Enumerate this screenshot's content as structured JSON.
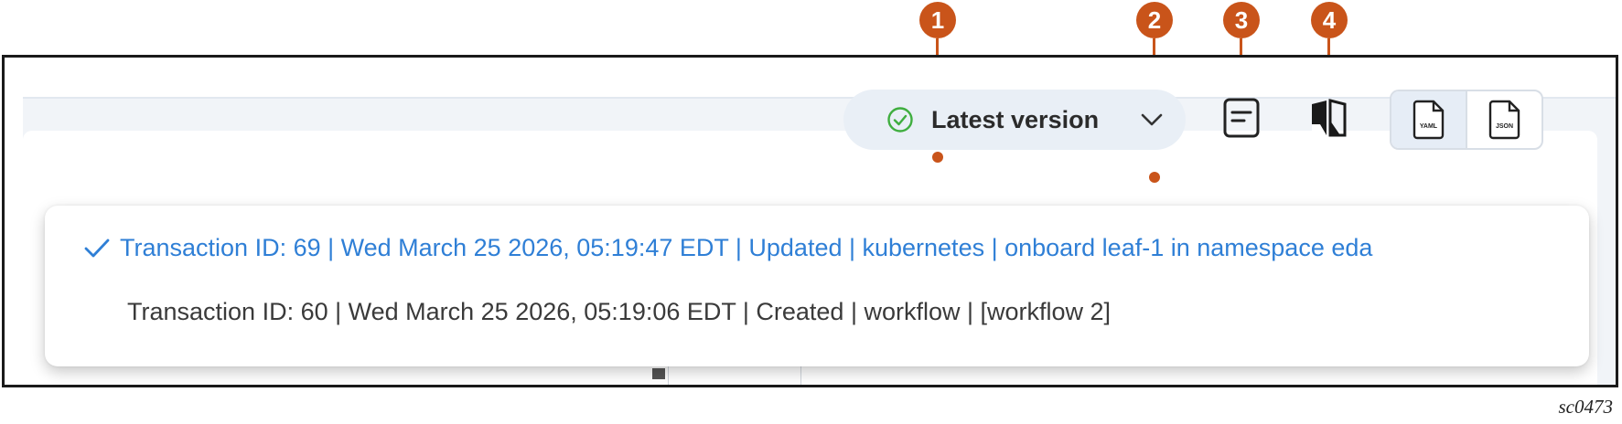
{
  "callouts": [
    "1",
    "2",
    "3",
    "4"
  ],
  "version_selector": {
    "label": "Latest version",
    "status_icon": "check-circle-icon",
    "chevron_icon": "chevron-down-icon"
  },
  "toolbar": {
    "details_icon": "document-lines-icon",
    "compare_icon": "compare-split-icon",
    "format_options": [
      {
        "label": "YAML",
        "icon": "yaml-file-icon",
        "active": true
      },
      {
        "label": "JSON",
        "icon": "json-file-icon",
        "active": false
      }
    ]
  },
  "transactions": [
    {
      "text": "Transaction ID: 69 | Wed March 25 2026, 05:19:47 EDT | Updated | kubernetes | onboard leaf-1 in namespace eda",
      "selected": true
    },
    {
      "text": "Transaction ID: 60 | Wed March 25 2026, 05:19:06 EDT | Created | workflow | [workflow 2]",
      "selected": false
    }
  ],
  "figure_id": "sc0473",
  "colors": {
    "callout": "#c9541a",
    "selected_text": "#2f7fd6",
    "success": "#3fae3f"
  }
}
